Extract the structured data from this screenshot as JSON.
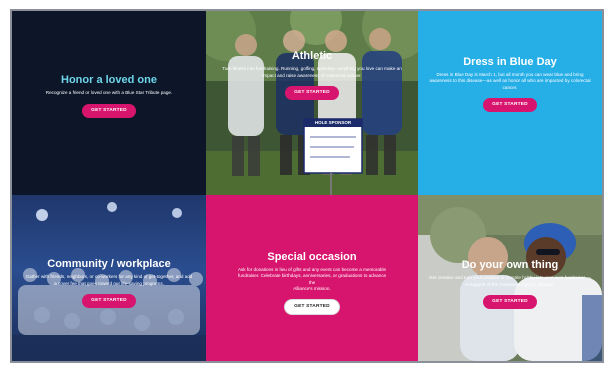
{
  "colors": {
    "navy": "#0c1628",
    "teal": "#6fd5ea",
    "blue": "#26aee7",
    "pink": "#d8156e",
    "white": "#ffffff"
  },
  "tiles": [
    {
      "title": "Honor a loved one",
      "description": "Recognize a friend or loved one with a Blue Star Tribute page.",
      "button": "GET STARTED"
    },
    {
      "title": "Athletic",
      "description": "Turn fitness into fundraising. Running, golfing, spinning—anything you love can make an impact and raise awareness of colorectal cancer.",
      "button": "GET STARTED",
      "sign_title": "HOLE SPONSOR"
    },
    {
      "title": "Dress in Blue Day",
      "description": "Dress in Blue Day is March 1, but all month you can wear blue and bring awareness to this disease—as well as honor all who are impacted by colorectal cancer.",
      "button": "GET STARTED"
    },
    {
      "title": "Community / workplace",
      "description": "Gather with friends, neighbors, or co-workers for any kind of get-together, and add a cover fee that goes toward our life-saving programs.",
      "button": "GET STARTED"
    },
    {
      "title": "Special occasion",
      "description_lines": [
        "Ask for donations in lieu of gifts and any event can become a memorable",
        "fundraiser. Celebrate birthdays, anniversaries, or graduations to advance",
        "the",
        "Alliance's mission."
      ],
      "button": "GET STARTED"
    },
    {
      "title": "Do your own thing",
      "description": "Get creative and turn your passion or favorite hobby into your own fundraiser — in support of the Colorectal Cancer Alliance.",
      "button": "GET STARTED"
    }
  ]
}
